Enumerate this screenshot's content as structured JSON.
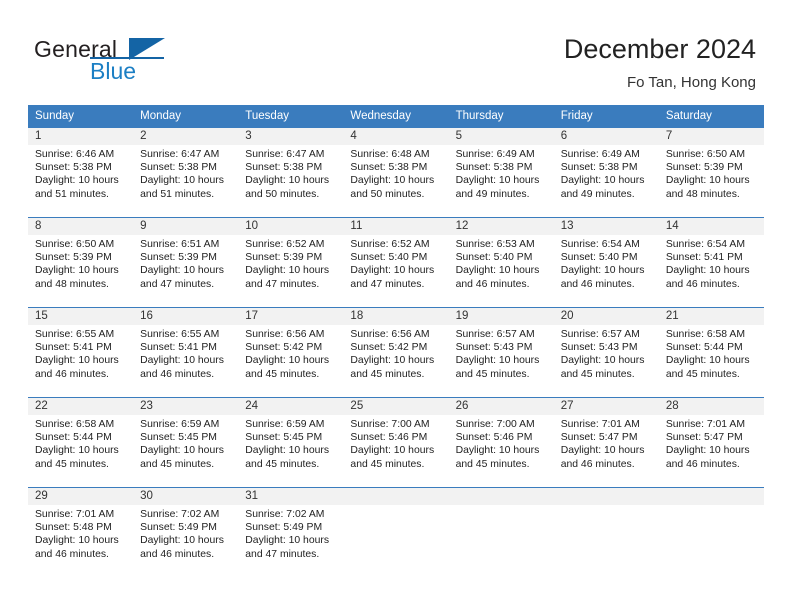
{
  "brand": {
    "name_part1": "General",
    "name_part2": "Blue",
    "accent_color": "#1464a5",
    "logo_icon": "triangle-logo-icon"
  },
  "header": {
    "title": "December 2024",
    "subtitle": "Fo Tan, Hong Kong"
  },
  "calendar": {
    "header_color": "#3a7cbe",
    "weekdays": [
      "Sunday",
      "Monday",
      "Tuesday",
      "Wednesday",
      "Thursday",
      "Friday",
      "Saturday"
    ],
    "weeks": [
      [
        {
          "day": "1",
          "sunrise": "Sunrise: 6:46 AM",
          "sunset": "Sunset: 5:38 PM",
          "daylight": "Daylight: 10 hours and 51 minutes."
        },
        {
          "day": "2",
          "sunrise": "Sunrise: 6:47 AM",
          "sunset": "Sunset: 5:38 PM",
          "daylight": "Daylight: 10 hours and 51 minutes."
        },
        {
          "day": "3",
          "sunrise": "Sunrise: 6:47 AM",
          "sunset": "Sunset: 5:38 PM",
          "daylight": "Daylight: 10 hours and 50 minutes."
        },
        {
          "day": "4",
          "sunrise": "Sunrise: 6:48 AM",
          "sunset": "Sunset: 5:38 PM",
          "daylight": "Daylight: 10 hours and 50 minutes."
        },
        {
          "day": "5",
          "sunrise": "Sunrise: 6:49 AM",
          "sunset": "Sunset: 5:38 PM",
          "daylight": "Daylight: 10 hours and 49 minutes."
        },
        {
          "day": "6",
          "sunrise": "Sunrise: 6:49 AM",
          "sunset": "Sunset: 5:38 PM",
          "daylight": "Daylight: 10 hours and 49 minutes."
        },
        {
          "day": "7",
          "sunrise": "Sunrise: 6:50 AM",
          "sunset": "Sunset: 5:39 PM",
          "daylight": "Daylight: 10 hours and 48 minutes."
        }
      ],
      [
        {
          "day": "8",
          "sunrise": "Sunrise: 6:50 AM",
          "sunset": "Sunset: 5:39 PM",
          "daylight": "Daylight: 10 hours and 48 minutes."
        },
        {
          "day": "9",
          "sunrise": "Sunrise: 6:51 AM",
          "sunset": "Sunset: 5:39 PM",
          "daylight": "Daylight: 10 hours and 47 minutes."
        },
        {
          "day": "10",
          "sunrise": "Sunrise: 6:52 AM",
          "sunset": "Sunset: 5:39 PM",
          "daylight": "Daylight: 10 hours and 47 minutes."
        },
        {
          "day": "11",
          "sunrise": "Sunrise: 6:52 AM",
          "sunset": "Sunset: 5:40 PM",
          "daylight": "Daylight: 10 hours and 47 minutes."
        },
        {
          "day": "12",
          "sunrise": "Sunrise: 6:53 AM",
          "sunset": "Sunset: 5:40 PM",
          "daylight": "Daylight: 10 hours and 46 minutes."
        },
        {
          "day": "13",
          "sunrise": "Sunrise: 6:54 AM",
          "sunset": "Sunset: 5:40 PM",
          "daylight": "Daylight: 10 hours and 46 minutes."
        },
        {
          "day": "14",
          "sunrise": "Sunrise: 6:54 AM",
          "sunset": "Sunset: 5:41 PM",
          "daylight": "Daylight: 10 hours and 46 minutes."
        }
      ],
      [
        {
          "day": "15",
          "sunrise": "Sunrise: 6:55 AM",
          "sunset": "Sunset: 5:41 PM",
          "daylight": "Daylight: 10 hours and 46 minutes."
        },
        {
          "day": "16",
          "sunrise": "Sunrise: 6:55 AM",
          "sunset": "Sunset: 5:41 PM",
          "daylight": "Daylight: 10 hours and 46 minutes."
        },
        {
          "day": "17",
          "sunrise": "Sunrise: 6:56 AM",
          "sunset": "Sunset: 5:42 PM",
          "daylight": "Daylight: 10 hours and 45 minutes."
        },
        {
          "day": "18",
          "sunrise": "Sunrise: 6:56 AM",
          "sunset": "Sunset: 5:42 PM",
          "daylight": "Daylight: 10 hours and 45 minutes."
        },
        {
          "day": "19",
          "sunrise": "Sunrise: 6:57 AM",
          "sunset": "Sunset: 5:43 PM",
          "daylight": "Daylight: 10 hours and 45 minutes."
        },
        {
          "day": "20",
          "sunrise": "Sunrise: 6:57 AM",
          "sunset": "Sunset: 5:43 PM",
          "daylight": "Daylight: 10 hours and 45 minutes."
        },
        {
          "day": "21",
          "sunrise": "Sunrise: 6:58 AM",
          "sunset": "Sunset: 5:44 PM",
          "daylight": "Daylight: 10 hours and 45 minutes."
        }
      ],
      [
        {
          "day": "22",
          "sunrise": "Sunrise: 6:58 AM",
          "sunset": "Sunset: 5:44 PM",
          "daylight": "Daylight: 10 hours and 45 minutes."
        },
        {
          "day": "23",
          "sunrise": "Sunrise: 6:59 AM",
          "sunset": "Sunset: 5:45 PM",
          "daylight": "Daylight: 10 hours and 45 minutes."
        },
        {
          "day": "24",
          "sunrise": "Sunrise: 6:59 AM",
          "sunset": "Sunset: 5:45 PM",
          "daylight": "Daylight: 10 hours and 45 minutes."
        },
        {
          "day": "25",
          "sunrise": "Sunrise: 7:00 AM",
          "sunset": "Sunset: 5:46 PM",
          "daylight": "Daylight: 10 hours and 45 minutes."
        },
        {
          "day": "26",
          "sunrise": "Sunrise: 7:00 AM",
          "sunset": "Sunset: 5:46 PM",
          "daylight": "Daylight: 10 hours and 45 minutes."
        },
        {
          "day": "27",
          "sunrise": "Sunrise: 7:01 AM",
          "sunset": "Sunset: 5:47 PM",
          "daylight": "Daylight: 10 hours and 46 minutes."
        },
        {
          "day": "28",
          "sunrise": "Sunrise: 7:01 AM",
          "sunset": "Sunset: 5:47 PM",
          "daylight": "Daylight: 10 hours and 46 minutes."
        }
      ],
      [
        {
          "day": "29",
          "sunrise": "Sunrise: 7:01 AM",
          "sunset": "Sunset: 5:48 PM",
          "daylight": "Daylight: 10 hours and 46 minutes."
        },
        {
          "day": "30",
          "sunrise": "Sunrise: 7:02 AM",
          "sunset": "Sunset: 5:49 PM",
          "daylight": "Daylight: 10 hours and 46 minutes."
        },
        {
          "day": "31",
          "sunrise": "Sunrise: 7:02 AM",
          "sunset": "Sunset: 5:49 PM",
          "daylight": "Daylight: 10 hours and 47 minutes."
        },
        {
          "day": "",
          "sunrise": "",
          "sunset": "",
          "daylight": ""
        },
        {
          "day": "",
          "sunrise": "",
          "sunset": "",
          "daylight": ""
        },
        {
          "day": "",
          "sunrise": "",
          "sunset": "",
          "daylight": ""
        },
        {
          "day": "",
          "sunrise": "",
          "sunset": "",
          "daylight": ""
        }
      ]
    ]
  }
}
